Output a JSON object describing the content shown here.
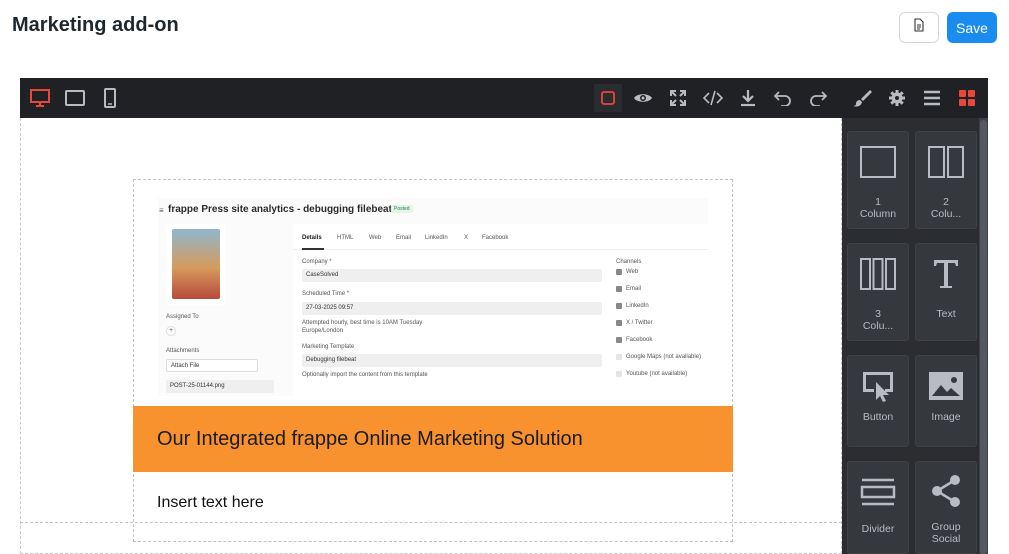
{
  "page": {
    "title": "Marketing add-on"
  },
  "header": {
    "save_label": "Save",
    "doc_icon": "document-icon"
  },
  "toolbar": {
    "devices": [
      "desktop-icon",
      "tablet-icon",
      "mobile-icon"
    ],
    "active_device": "desktop",
    "actions": [
      "border-toggle-icon",
      "eye-icon",
      "fullscreen-icon",
      "code-icon",
      "download-icon",
      "undo-icon",
      "redo-icon"
    ],
    "panels": [
      "brush-icon",
      "gear-icon",
      "layers-icon",
      "blocks-icon"
    ],
    "active_panel": "blocks",
    "accent_color": "#e8473c"
  },
  "email": {
    "banner_text": "Our Integrated frappe Online Marketing Solution",
    "banner_color": "#f8922f",
    "insert_text": "Insert text here",
    "screenshot": {
      "title": "frappe Press site analytics - debugging filebeat",
      "status": "Posted",
      "tabs": [
        "Details",
        "HTML",
        "Web",
        "Email",
        "LinkedIn",
        "X",
        "Facebook"
      ],
      "assigned_to": "Assigned To",
      "attachments": "Attachments",
      "attach_file": "Attach File",
      "attachment_name": "POST-25-01144.png",
      "company_label": "Company *",
      "company_value": "CaseSolved",
      "scheduled_label": "Scheduled Time *",
      "scheduled_value": "27-03-2025 09:57",
      "scheduled_note": "Attempted hourly, best time is 10AM Tuesday",
      "timezone": "Europe/London",
      "template_label": "Marketing Template",
      "template_value": "Debugging filebeat",
      "template_note": "Optionally import the content from this template",
      "channels_label": "Channels",
      "channels": [
        {
          "label": "Web",
          "checked": true
        },
        {
          "label": "Email",
          "checked": true
        },
        {
          "label": "LinkedIn",
          "checked": true
        },
        {
          "label": "X / Twitter",
          "checked": true
        },
        {
          "label": "Facebook",
          "checked": true
        },
        {
          "label": "Google Maps (not available)",
          "checked": false
        },
        {
          "label": "Youtube (not available)",
          "checked": false
        }
      ]
    }
  },
  "blocks": [
    {
      "label_line1": "1",
      "label_line2": "Column",
      "icon": "one-column-icon"
    },
    {
      "label_line1": "2",
      "label_line2": "Colu...",
      "icon": "two-column-icon"
    },
    {
      "label_line1": "3",
      "label_line2": "Colu...",
      "icon": "three-column-icon"
    },
    {
      "label_line1": "",
      "label_line2": "Text",
      "icon": "text-icon"
    },
    {
      "label_line1": "",
      "label_line2": "Button",
      "icon": "button-icon"
    },
    {
      "label_line1": "",
      "label_line2": "Image",
      "icon": "image-icon"
    },
    {
      "label_line1": "",
      "label_line2": "Divider",
      "icon": "divider-icon"
    },
    {
      "label_line1": "Group",
      "label_line2": "Social",
      "icon": "share-icon"
    }
  ]
}
